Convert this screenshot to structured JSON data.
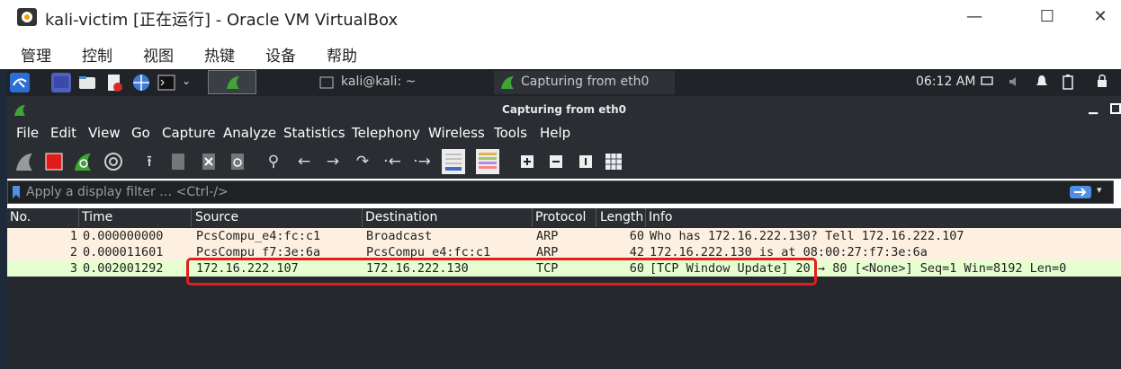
{
  "window": {
    "title": "kali-victim [正在运行] - Oracle VM VirtualBox",
    "minimize": "—",
    "maximize": "☐",
    "close": "✕"
  },
  "vbox_menu": [
    "管理",
    "控制",
    "视图",
    "热键",
    "设备",
    "帮助"
  ],
  "kali_panel": {
    "tasks": [
      {
        "label": "kali@kali: ~",
        "icon": "terminal-icon"
      },
      {
        "label": "Capturing from eth0",
        "icon": "wireshark-fin-icon"
      }
    ],
    "clock": "06:12 AM"
  },
  "wireshark": {
    "title": "Capturing from eth0",
    "menu": [
      "File",
      "Edit",
      "View",
      "Go",
      "Capture",
      "Analyze",
      "Statistics",
      "Telephony",
      "Wireless",
      "Tools",
      "Help"
    ],
    "filter_placeholder": "Apply a display filter … <Ctrl-/>",
    "columns": [
      "No.",
      "Time",
      "Source",
      "Destination",
      "Protocol",
      "Length",
      "Info"
    ],
    "packets": [
      {
        "no": "1",
        "time": "0.000000000",
        "source": "PcsCompu_e4:fc:c1",
        "destination": "Broadcast",
        "protocol": "ARP",
        "length": "60",
        "info": "Who has 172.16.222.130? Tell 172.16.222.107",
        "color": "#fdf0e0"
      },
      {
        "no": "2",
        "time": "0.000011601",
        "source": "PcsCompu_f7:3e:6a",
        "destination": "PcsCompu_e4:fc:c1",
        "protocol": "ARP",
        "length": "42",
        "info": "172.16.222.130 is at 08:00:27:f7:3e:6a",
        "color": "#fdf0e0"
      },
      {
        "no": "3",
        "time": "0.002001292",
        "source": "172.16.222.107",
        "destination": "172.16.222.130",
        "protocol": "TCP",
        "length": "60",
        "info": "[TCP Window Update] 20 → 80 [<None>] Seq=1 Win=8192 Len=0",
        "color": "#e6ffd0"
      }
    ]
  },
  "colors": {
    "accent_green": "#4caf50",
    "capture_stop_red": "#e01b1b",
    "highlight_red": "#e41e1e"
  }
}
